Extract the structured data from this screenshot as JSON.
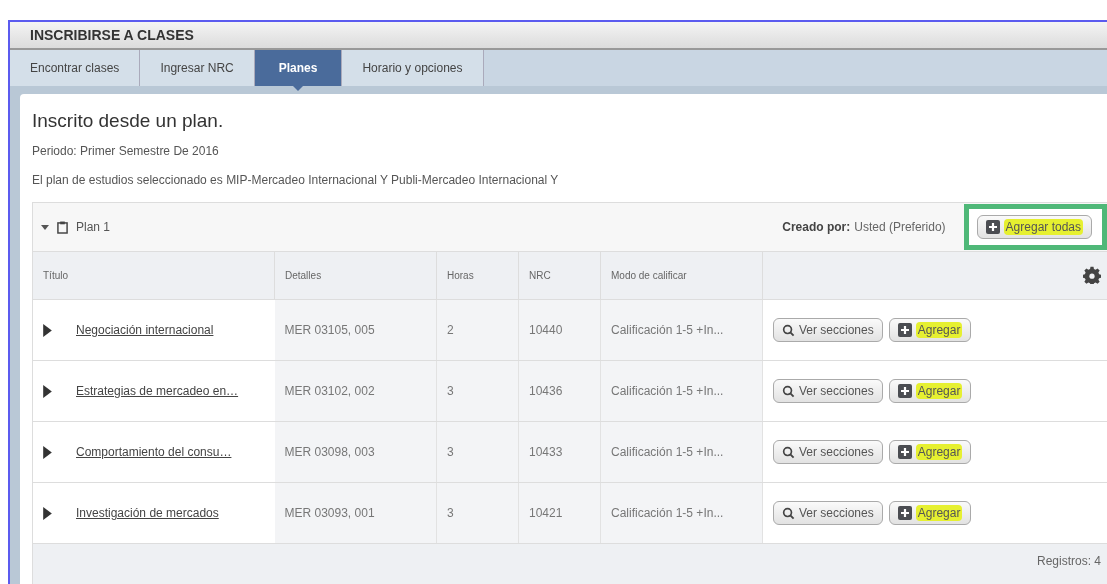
{
  "window": {
    "title": "INSCRIBIRSE A CLASES"
  },
  "tabs": [
    {
      "label": "Encontrar clases",
      "selected": false
    },
    {
      "label": "Ingresar NRC",
      "selected": false
    },
    {
      "label": "Planes",
      "selected": true
    },
    {
      "label": "Horario y opciones",
      "selected": false
    }
  ],
  "heading": "Inscrito desde un plan.",
  "period": "Periodo: Primer Semestre De 2016",
  "plan_info": "El plan de estudios seleccionado es MIP-Mercadeo Internacional Y Publi-Mercadeo Internacional Y",
  "plan": {
    "name": "Plan 1",
    "expanded": true,
    "created_label": "Creado por:",
    "created_value": "Usted (Preferido)",
    "add_all": {
      "label": "Agregar todas",
      "highlighted": true,
      "framed": true
    }
  },
  "table": {
    "columns": [
      "Título",
      "Detalles",
      "Horas",
      "NRC",
      "Modo de calificar"
    ],
    "rows": [
      {
        "title": "Negociación internacional",
        "details": "MER 03105, 005",
        "hours": "2",
        "nrc": "10440",
        "mode": "Calificación 1-5 +In...",
        "view_label": "Ver secciones",
        "add": {
          "label": "Agregar",
          "highlighted": true
        }
      },
      {
        "title": "Estrategias de mercadeo en…",
        "details": "MER 03102, 002",
        "hours": "3",
        "nrc": "10436",
        "mode": "Calificación 1-5 +In...",
        "view_label": "Ver secciones",
        "add": {
          "label": "Agregar",
          "highlighted": true
        }
      },
      {
        "title": "Comportamiento del consu…",
        "details": "MER 03098, 003",
        "hours": "3",
        "nrc": "10433",
        "mode": "Calificación 1-5 +In...",
        "view_label": "Ver secciones",
        "add": {
          "label": "Agregar",
          "highlighted": true
        }
      },
      {
        "title": "Investigación de mercados",
        "details": "MER 03093, 001",
        "hours": "3",
        "nrc": "10421",
        "mode": "Calificación 1-5 +In...",
        "view_label": "Ver secciones",
        "add": {
          "label": "Agregar",
          "highlighted": true
        }
      }
    ],
    "footer": "Registros: 4"
  }
}
